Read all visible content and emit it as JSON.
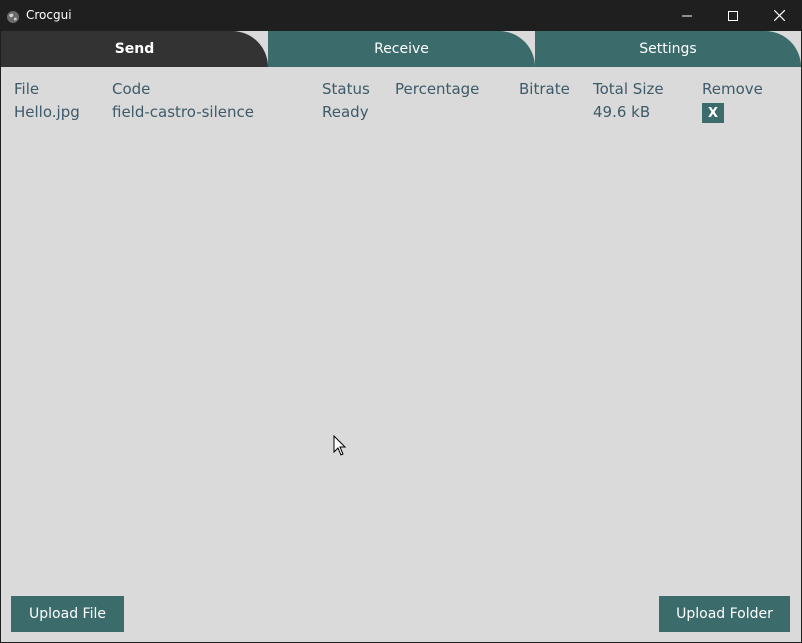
{
  "window": {
    "title": "Crocgui"
  },
  "tabs": [
    {
      "label": "Send"
    },
    {
      "label": "Receive"
    },
    {
      "label": "Settings"
    }
  ],
  "table": {
    "headers": [
      "File",
      "Code",
      "Status",
      "Percentage",
      "Bitrate",
      "Total Size",
      "Remove"
    ],
    "rows": [
      {
        "file": "Hello.jpg",
        "code": "field-castro-silence",
        "status": "Ready",
        "percentage": "",
        "bitrate": "",
        "total_size": "49.6 kB",
        "remove": "X"
      }
    ]
  },
  "buttons": {
    "upload_file": "Upload File",
    "upload_folder": "Upload Folder"
  },
  "icons": {
    "app": "globe-icon",
    "minimize": "minimize-icon",
    "maximize": "maximize-icon",
    "close": "close-icon"
  },
  "colors": {
    "accent": "#3b6b6b",
    "active_tab": "#333333",
    "background": "#dadada",
    "text": "#3e5a68",
    "titlebar": "#1f1f1f"
  }
}
